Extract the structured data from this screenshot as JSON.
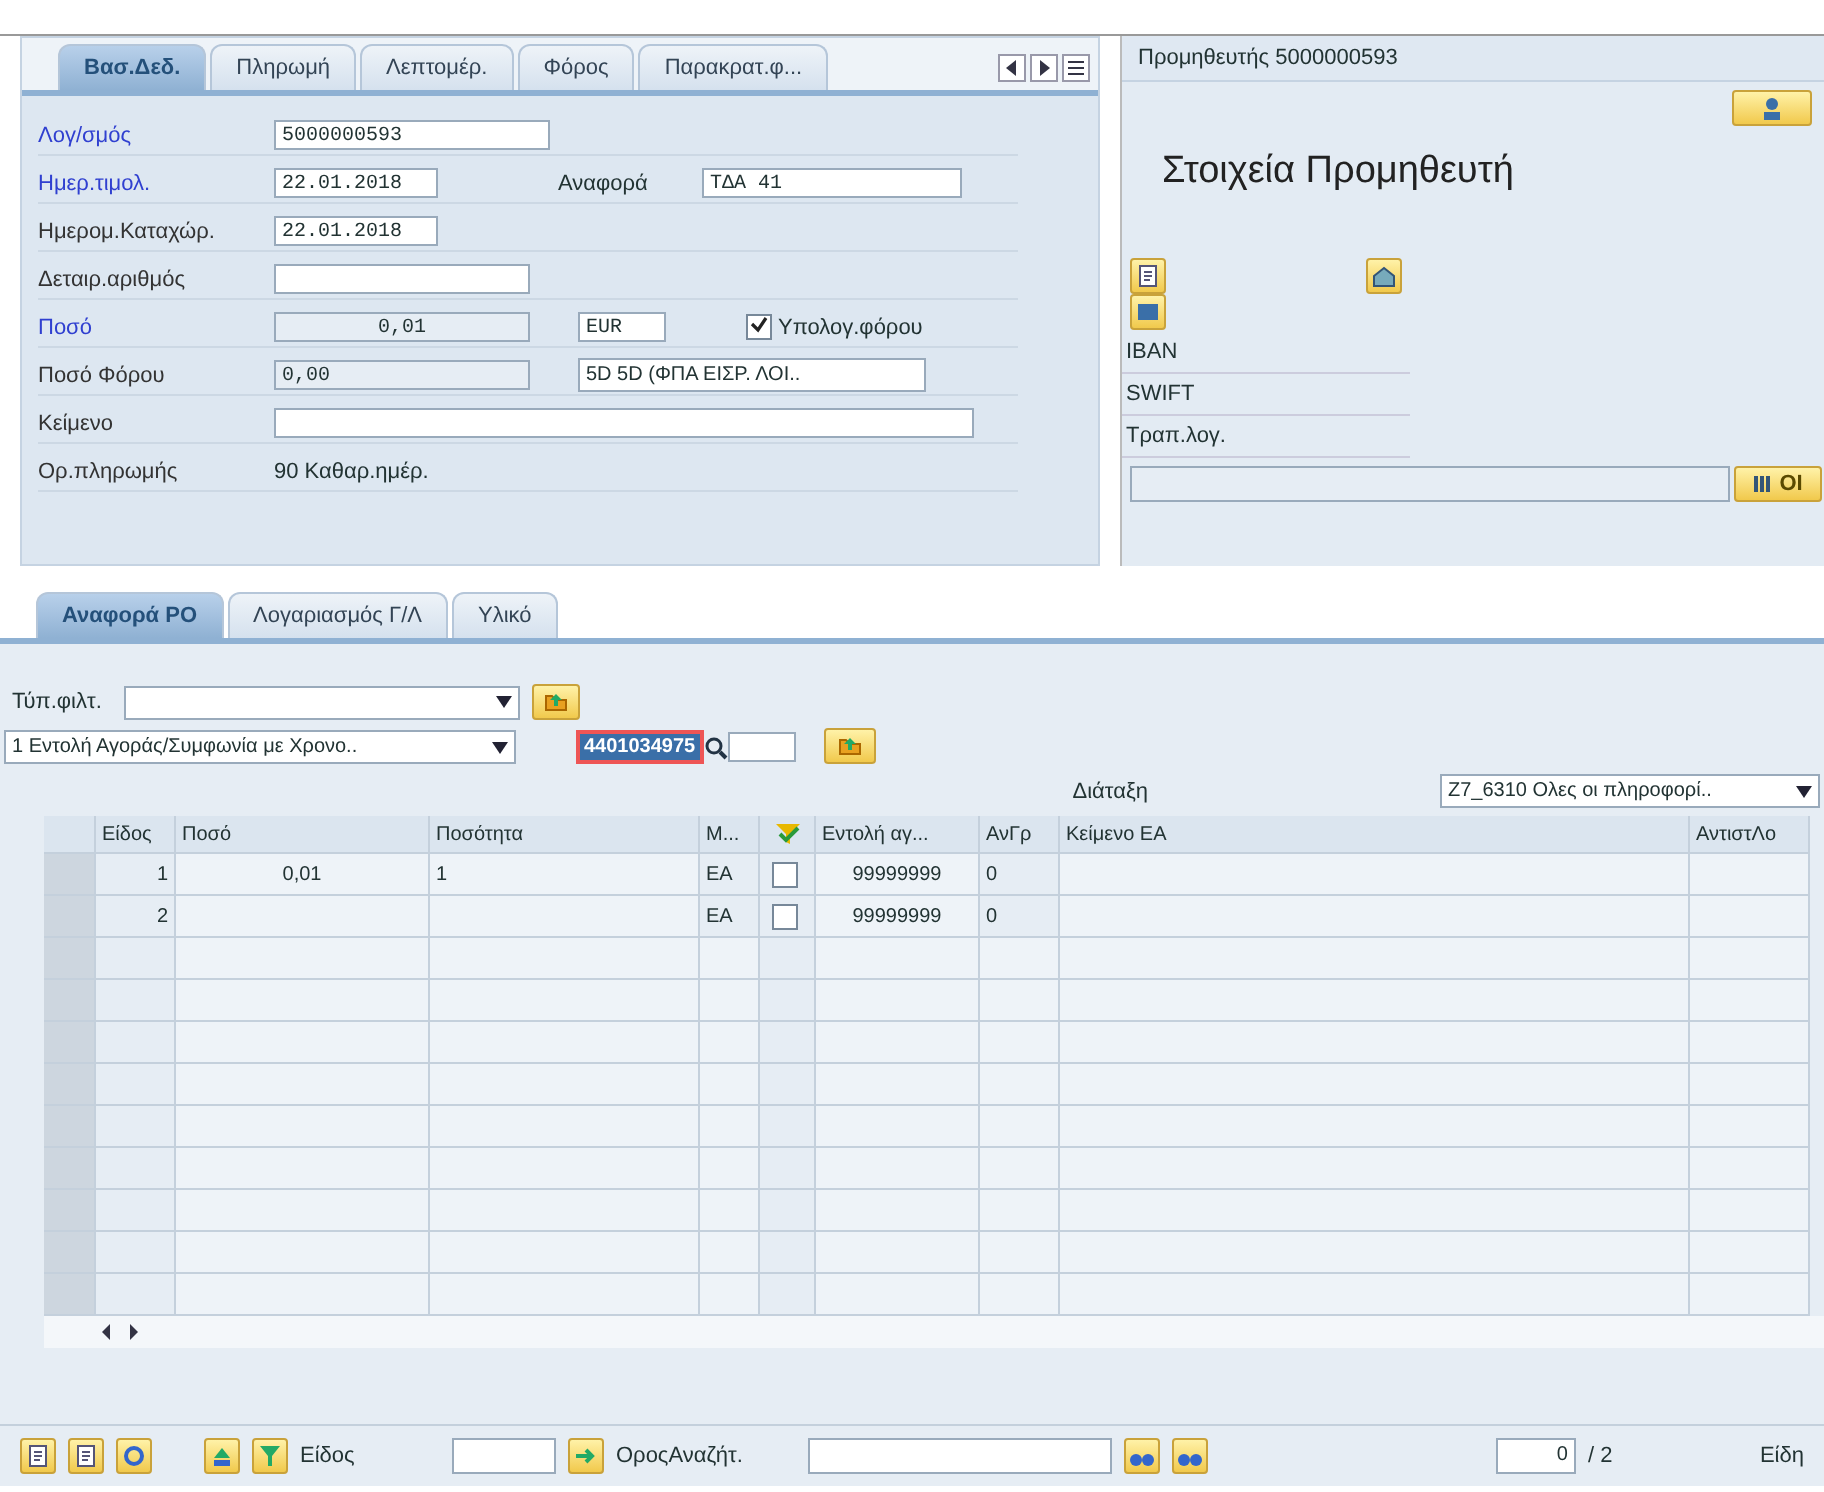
{
  "header_tabs": [
    {
      "label": "Βασ.Δεδ.",
      "selected": true
    },
    {
      "label": "Πληρωμή",
      "selected": false
    },
    {
      "label": "Λεπτομέρ.",
      "selected": false
    },
    {
      "label": "Φόρος",
      "selected": false
    },
    {
      "label": "Παρακρατ.φ...",
      "selected": false
    }
  ],
  "form": {
    "account": {
      "label": "Λογ/σμός",
      "required": true,
      "value": "5000000593"
    },
    "invoice_date": {
      "label": "Ημερ.τιμολ.",
      "required": true,
      "value": "22.01.2018"
    },
    "reference": {
      "label": "Αναφορά",
      "value": "ΤΔΑ 41"
    },
    "posting_date": {
      "label": "Ημερομ.Καταχώρ.",
      "required": false,
      "value": "22.01.2018"
    },
    "detail_number": {
      "label": "Δεταιρ.αριθμός",
      "required": false
    },
    "amount": {
      "label": "Ποσό",
      "required": true,
      "value": "0,01",
      "currency": "EUR"
    },
    "calc_tax": {
      "label": "Υπολογ.φόρου",
      "checked": true
    },
    "tax_amount": {
      "label": "Ποσό Φόρου",
      "required": false,
      "value": "0,00"
    },
    "tax_code": {
      "value": "5D 5D (ΦΠΑ ΕΙΣΡ. ΛΟΙ.."
    },
    "text": {
      "label": "Κείμενο",
      "required": false
    },
    "payment_terms": {
      "label": "Ορ.πληρωμής",
      "required": false,
      "value": "90 Καθαρ.ημέρ."
    }
  },
  "vendor_panel": {
    "title": "Προμηθευτής 5000000593",
    "heading": "Στοιχεία Προμηθευτή",
    "labels": [
      "IBAN",
      "SWIFT",
      "Τραπ.λογ."
    ],
    "button": "OI"
  },
  "item_tabs": [
    {
      "label": "Αναφορά PO",
      "selected": true
    },
    {
      "label": "Λογαριασμός Γ/Λ",
      "selected": false
    },
    {
      "label": "Υλικό",
      "selected": false
    }
  ],
  "filter": {
    "label": "Τύπ.φιλτ.",
    "doc_type": "1 Εντολή Αγοράς/Συμφωνία με Χρονο..",
    "po_number": "4401034975",
    "layout_label": "Διάταξη",
    "layout": "Z7_6310 Ολες οι πληροφορί.."
  },
  "table": {
    "columns": [
      {
        "kind": "text",
        "label": "Είδος"
      },
      {
        "kind": "text",
        "label": "Ποσό"
      },
      {
        "kind": "text",
        "label": "Ποσότητα"
      },
      {
        "kind": "text",
        "label": "Μ..."
      },
      {
        "kind": "icon"
      },
      {
        "kind": "text",
        "label": "Εντολή αγ..."
      },
      {
        "kind": "text",
        "label": "ΑνΓρ"
      },
      {
        "kind": "text",
        "label": "Κείμενο ΕΑ"
      },
      {
        "kind": "text",
        "label": "ΑντιστΛο"
      }
    ],
    "rows": [
      {
        "item": "1",
        "amount": "0,01",
        "quantity": "1",
        "unit": "EA",
        "checked": false,
        "po": "99999999",
        "ref": "0"
      },
      {
        "item": "2",
        "unit": "EA",
        "checked": false,
        "po": "99999999",
        "ref": "0"
      }
    ]
  },
  "footer": {
    "item_label": "Είδος",
    "search_label": "ΟροςΑναζήτ.",
    "page": "0",
    "total": "/ 2",
    "items_label": "Είδη"
  }
}
